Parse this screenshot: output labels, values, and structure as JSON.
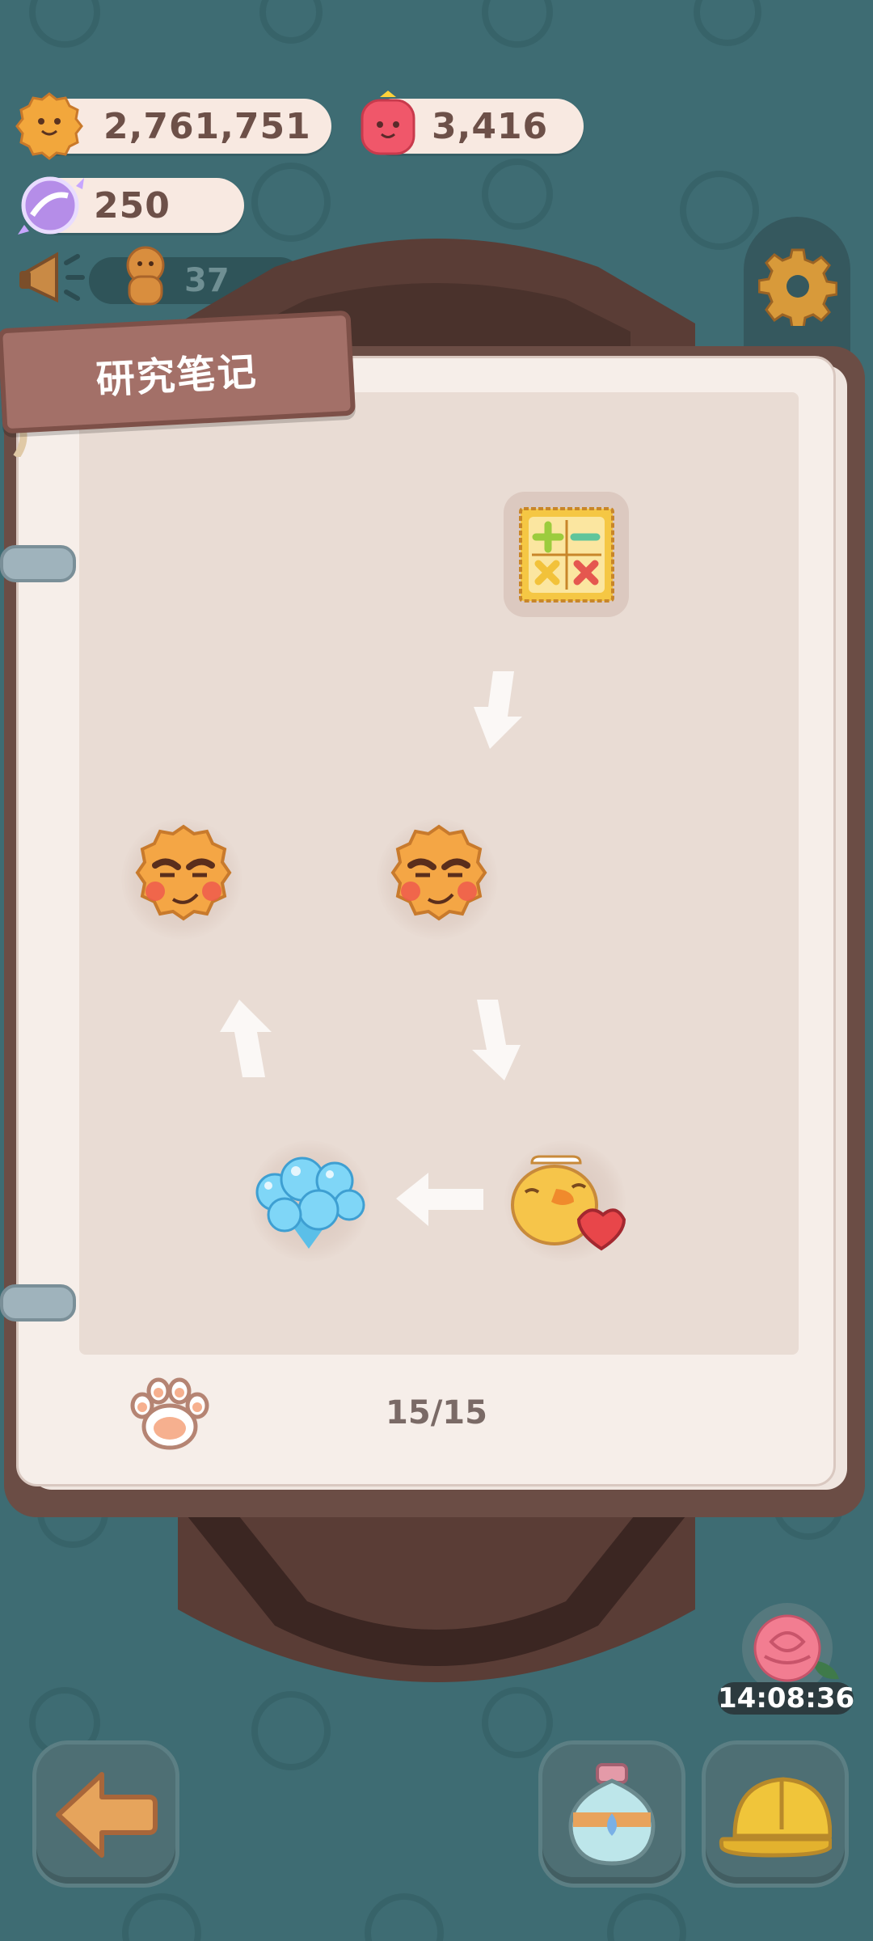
{
  "resources": {
    "cookies": {
      "value": "2,761,751",
      "icon": "cookie-coin-icon"
    },
    "jelly": {
      "value": "3,416",
      "icon": "red-jelly-icon"
    },
    "crystal": {
      "value": "250",
      "icon": "crystal-candy-icon"
    }
  },
  "notice": {
    "count": "37",
    "icon": "megaphone-icon"
  },
  "notebook": {
    "title": "研究笔记",
    "page_counter": "15/15",
    "items": [
      {
        "icon": "calculator-biscuit-icon"
      },
      {
        "icon": "smug-cookie-icon"
      },
      {
        "icon": "smug-cookie-icon"
      },
      {
        "icon": "duck-with-heart-icon"
      },
      {
        "icon": "bubble-cluster-icon"
      }
    ]
  },
  "timer": {
    "value": "14:08:36"
  },
  "colors": {
    "background": "#3e6c73",
    "tag": "#a37068",
    "pill": "#f8e9e1"
  }
}
